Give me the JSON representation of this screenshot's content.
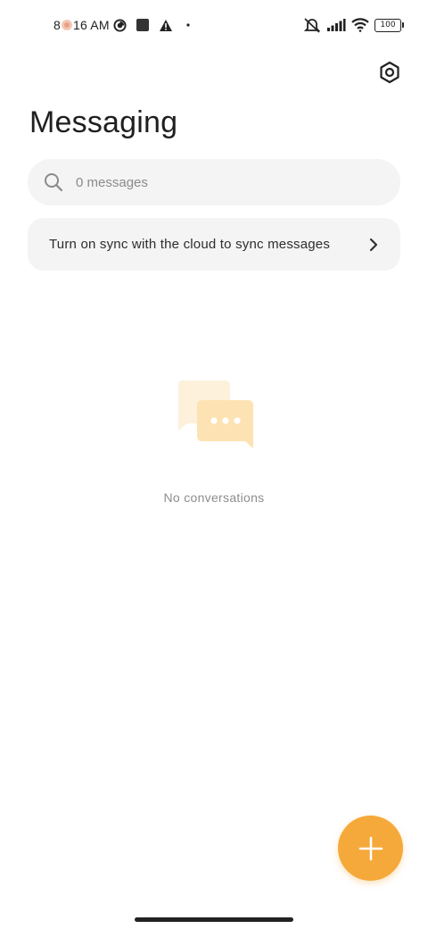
{
  "status_bar": {
    "time": "8:16 AM",
    "battery_level": "100",
    "icons": [
      "notification-emoji-icon",
      "app-circle-icon",
      "square-app-icon",
      "warning-icon",
      "dot-icon",
      "silent-icon",
      "signal-icon",
      "wifi-icon",
      "battery-icon"
    ]
  },
  "header": {
    "title": "Messaging",
    "settings_icon": "settings-hexagon-icon"
  },
  "search": {
    "placeholder": "0 messages",
    "value": "",
    "icon": "search-icon"
  },
  "sync_banner": {
    "text": "Turn on sync with the cloud to sync messages",
    "icon": "chevron-right-icon"
  },
  "empty_state": {
    "text": "No conversations",
    "icon": "chat-bubbles-icon"
  },
  "fab": {
    "icon": "plus-icon"
  },
  "colors": {
    "accent": "#f5a93a",
    "surface": "#f4f4f4",
    "illustration_back": "#fdf1dc",
    "illustration_front": "#fde3b3"
  }
}
